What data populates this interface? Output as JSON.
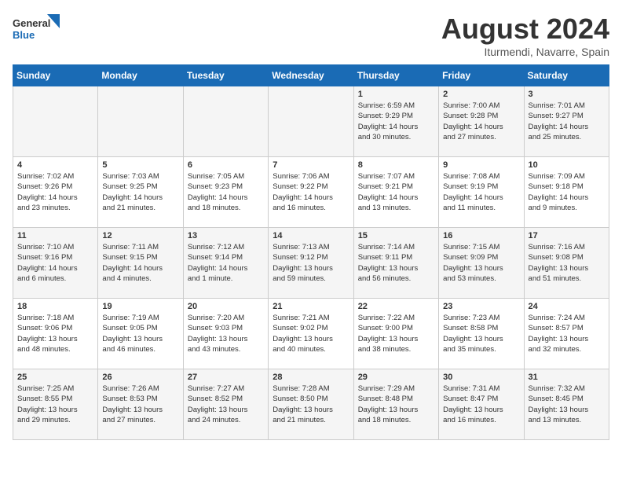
{
  "logo": {
    "text_general": "General",
    "text_blue": "Blue"
  },
  "title": {
    "month_year": "August 2024",
    "location": "Iturmendi, Navarre, Spain"
  },
  "weekdays": [
    "Sunday",
    "Monday",
    "Tuesday",
    "Wednesday",
    "Thursday",
    "Friday",
    "Saturday"
  ],
  "weeks": [
    [
      {
        "day": "",
        "info": ""
      },
      {
        "day": "",
        "info": ""
      },
      {
        "day": "",
        "info": ""
      },
      {
        "day": "",
        "info": ""
      },
      {
        "day": "1",
        "info": "Sunrise: 6:59 AM\nSunset: 9:29 PM\nDaylight: 14 hours\nand 30 minutes."
      },
      {
        "day": "2",
        "info": "Sunrise: 7:00 AM\nSunset: 9:28 PM\nDaylight: 14 hours\nand 27 minutes."
      },
      {
        "day": "3",
        "info": "Sunrise: 7:01 AM\nSunset: 9:27 PM\nDaylight: 14 hours\nand 25 minutes."
      }
    ],
    [
      {
        "day": "4",
        "info": "Sunrise: 7:02 AM\nSunset: 9:26 PM\nDaylight: 14 hours\nand 23 minutes."
      },
      {
        "day": "5",
        "info": "Sunrise: 7:03 AM\nSunset: 9:25 PM\nDaylight: 14 hours\nand 21 minutes."
      },
      {
        "day": "6",
        "info": "Sunrise: 7:05 AM\nSunset: 9:23 PM\nDaylight: 14 hours\nand 18 minutes."
      },
      {
        "day": "7",
        "info": "Sunrise: 7:06 AM\nSunset: 9:22 PM\nDaylight: 14 hours\nand 16 minutes."
      },
      {
        "day": "8",
        "info": "Sunrise: 7:07 AM\nSunset: 9:21 PM\nDaylight: 14 hours\nand 13 minutes."
      },
      {
        "day": "9",
        "info": "Sunrise: 7:08 AM\nSunset: 9:19 PM\nDaylight: 14 hours\nand 11 minutes."
      },
      {
        "day": "10",
        "info": "Sunrise: 7:09 AM\nSunset: 9:18 PM\nDaylight: 14 hours\nand 9 minutes."
      }
    ],
    [
      {
        "day": "11",
        "info": "Sunrise: 7:10 AM\nSunset: 9:16 PM\nDaylight: 14 hours\nand 6 minutes."
      },
      {
        "day": "12",
        "info": "Sunrise: 7:11 AM\nSunset: 9:15 PM\nDaylight: 14 hours\nand 4 minutes."
      },
      {
        "day": "13",
        "info": "Sunrise: 7:12 AM\nSunset: 9:14 PM\nDaylight: 14 hours\nand 1 minute."
      },
      {
        "day": "14",
        "info": "Sunrise: 7:13 AM\nSunset: 9:12 PM\nDaylight: 13 hours\nand 59 minutes."
      },
      {
        "day": "15",
        "info": "Sunrise: 7:14 AM\nSunset: 9:11 PM\nDaylight: 13 hours\nand 56 minutes."
      },
      {
        "day": "16",
        "info": "Sunrise: 7:15 AM\nSunset: 9:09 PM\nDaylight: 13 hours\nand 53 minutes."
      },
      {
        "day": "17",
        "info": "Sunrise: 7:16 AM\nSunset: 9:08 PM\nDaylight: 13 hours\nand 51 minutes."
      }
    ],
    [
      {
        "day": "18",
        "info": "Sunrise: 7:18 AM\nSunset: 9:06 PM\nDaylight: 13 hours\nand 48 minutes."
      },
      {
        "day": "19",
        "info": "Sunrise: 7:19 AM\nSunset: 9:05 PM\nDaylight: 13 hours\nand 46 minutes."
      },
      {
        "day": "20",
        "info": "Sunrise: 7:20 AM\nSunset: 9:03 PM\nDaylight: 13 hours\nand 43 minutes."
      },
      {
        "day": "21",
        "info": "Sunrise: 7:21 AM\nSunset: 9:02 PM\nDaylight: 13 hours\nand 40 minutes."
      },
      {
        "day": "22",
        "info": "Sunrise: 7:22 AM\nSunset: 9:00 PM\nDaylight: 13 hours\nand 38 minutes."
      },
      {
        "day": "23",
        "info": "Sunrise: 7:23 AM\nSunset: 8:58 PM\nDaylight: 13 hours\nand 35 minutes."
      },
      {
        "day": "24",
        "info": "Sunrise: 7:24 AM\nSunset: 8:57 PM\nDaylight: 13 hours\nand 32 minutes."
      }
    ],
    [
      {
        "day": "25",
        "info": "Sunrise: 7:25 AM\nSunset: 8:55 PM\nDaylight: 13 hours\nand 29 minutes."
      },
      {
        "day": "26",
        "info": "Sunrise: 7:26 AM\nSunset: 8:53 PM\nDaylight: 13 hours\nand 27 minutes."
      },
      {
        "day": "27",
        "info": "Sunrise: 7:27 AM\nSunset: 8:52 PM\nDaylight: 13 hours\nand 24 minutes."
      },
      {
        "day": "28",
        "info": "Sunrise: 7:28 AM\nSunset: 8:50 PM\nDaylight: 13 hours\nand 21 minutes."
      },
      {
        "day": "29",
        "info": "Sunrise: 7:29 AM\nSunset: 8:48 PM\nDaylight: 13 hours\nand 18 minutes."
      },
      {
        "day": "30",
        "info": "Sunrise: 7:31 AM\nSunset: 8:47 PM\nDaylight: 13 hours\nand 16 minutes."
      },
      {
        "day": "31",
        "info": "Sunrise: 7:32 AM\nSunset: 8:45 PM\nDaylight: 13 hours\nand 13 minutes."
      }
    ]
  ]
}
